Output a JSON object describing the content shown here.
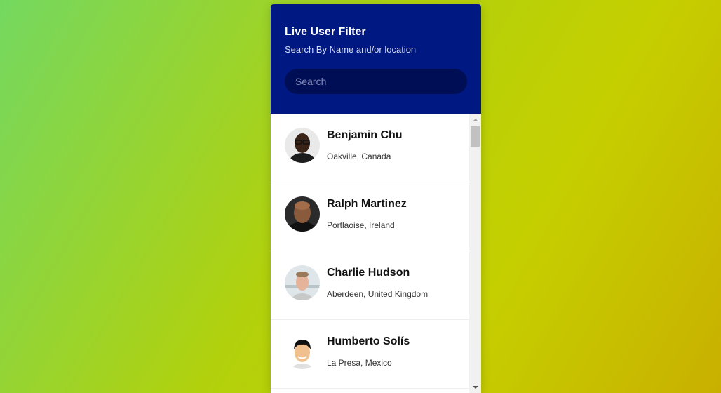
{
  "header": {
    "title": "Live User Filter",
    "subtitle": "Search By Name and/or location"
  },
  "search": {
    "placeholder": "Search",
    "value": ""
  },
  "users": [
    {
      "name": "Benjamin Chu",
      "location": "Oakville, Canada",
      "avatar_icon": "person-dark-skin-glasses"
    },
    {
      "name": "Ralph Martinez",
      "location": "Portlaoise, Ireland",
      "avatar_icon": "person-bald"
    },
    {
      "name": "Charlie Hudson",
      "location": "Aberdeen, United Kingdom",
      "avatar_icon": "person-light-skin"
    },
    {
      "name": "Humberto Solís",
      "location": "La Presa, Mexico",
      "avatar_icon": "person-smiling"
    }
  ],
  "colors": {
    "header_bg": "#001881",
    "search_bg": "#000e55",
    "background_gradient_start": "#74d860",
    "background_gradient_end": "#c9b000"
  }
}
